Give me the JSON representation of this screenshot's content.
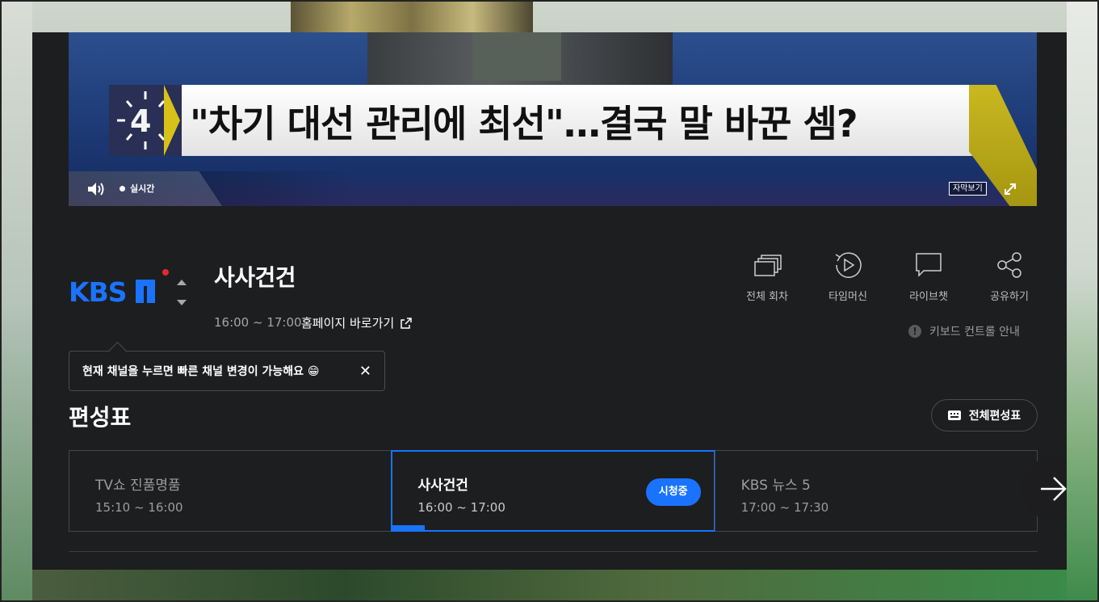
{
  "video": {
    "caption_number": "4",
    "caption_headline": "\"차기 대선 관리에 최선\"…결국 말 바꾼 셈?",
    "live_label": "실시간",
    "subtitle_button": "자막보기"
  },
  "channel": {
    "logo_text": "KBS 1",
    "brand_color": "#1a73ff"
  },
  "program": {
    "title": "사사건건",
    "time": "16:00 ~ 17:00",
    "homepage_link": "홈페이지 바로가기"
  },
  "actions": [
    {
      "label": "전체 회차",
      "icon": "episodes-icon"
    },
    {
      "label": "타임머신",
      "icon": "timemachine-icon"
    },
    {
      "label": "라이브챗",
      "icon": "chat-icon"
    },
    {
      "label": "공유하기",
      "icon": "share-icon"
    }
  ],
  "keyboard_guide": "키보드 컨트롤 안내",
  "tooltip": {
    "text": "현재 채널을 누르면 빠른 채널 변경이 가능해요 😁",
    "close": "✕"
  },
  "schedule": {
    "title": "편성표",
    "full_button": "전체편성표",
    "items": [
      {
        "name": "TV쇼 진품명품",
        "time": "15:10 ~ 16:00"
      },
      {
        "name": "사사건건",
        "time": "16:00 ~ 17:00",
        "badge": "시청중",
        "progress_percent": 10
      },
      {
        "name": "KBS 뉴스 5",
        "time": "17:00 ~ 17:30"
      }
    ]
  },
  "colors": {
    "accent": "#1a73ff",
    "panel_bg": "#1d1e20",
    "logo_red": "#e8262d"
  }
}
